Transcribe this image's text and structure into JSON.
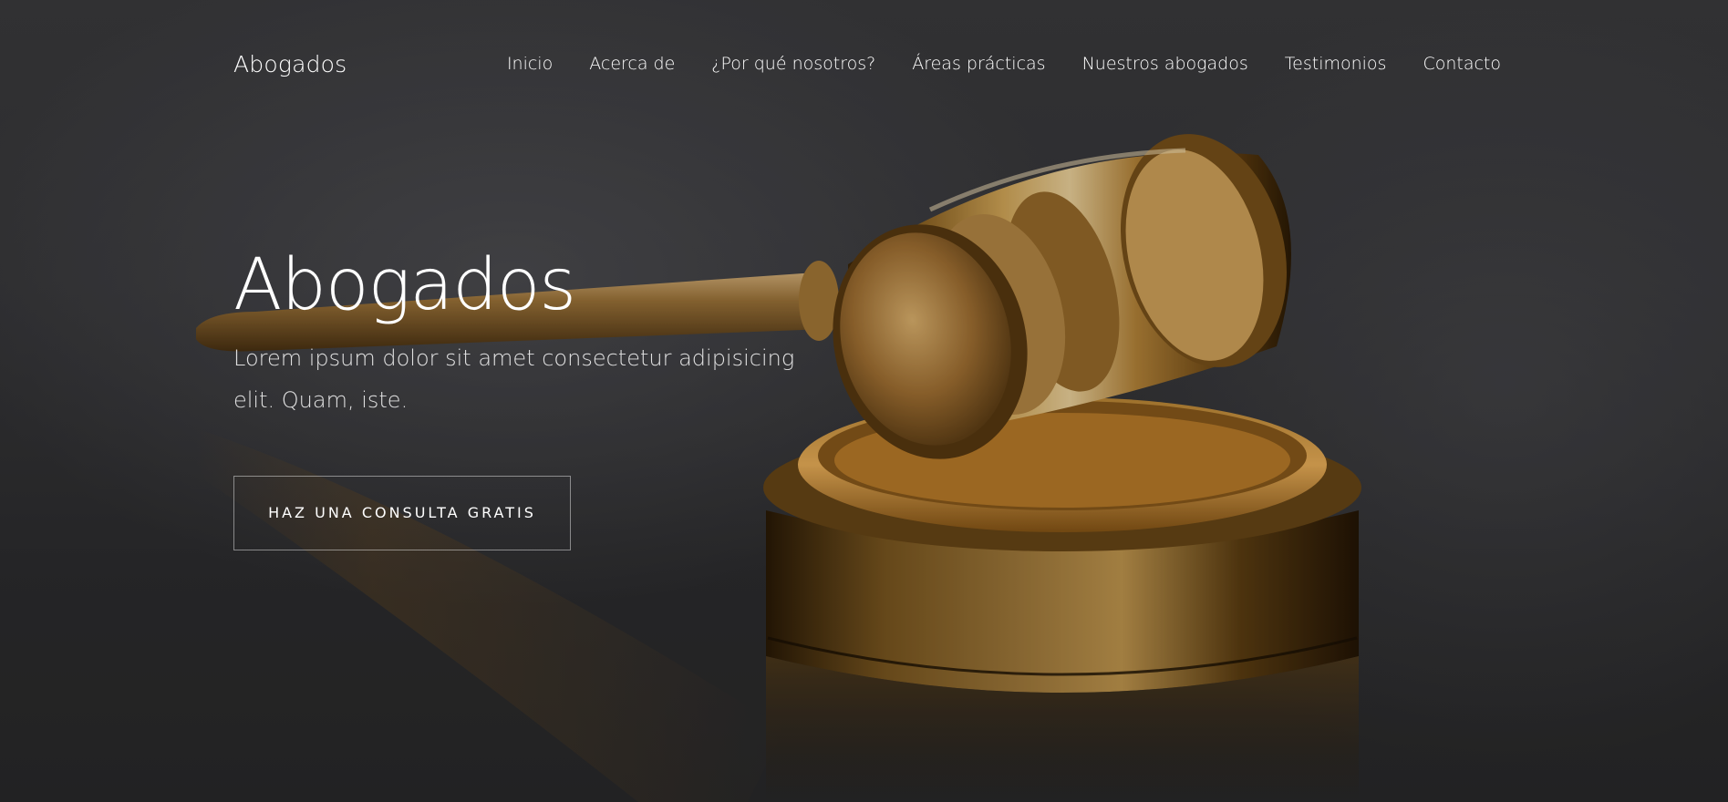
{
  "brand": "Abogados",
  "nav": {
    "items": [
      {
        "label": "Inicio"
      },
      {
        "label": "Acerca de"
      },
      {
        "label": "¿Por qué nosotros?"
      },
      {
        "label": "Áreas prácticas"
      },
      {
        "label": "Nuestros abogados"
      },
      {
        "label": "Testimonios"
      },
      {
        "label": "Contacto"
      }
    ]
  },
  "hero": {
    "title": "Abogados",
    "subtitle": "Lorem ipsum dolor sit amet consectetur adipisicing elit. Quam, iste.",
    "cta_label": "HAZ UNA CONSULTA GRATIS",
    "image": "gold-gavel-image"
  },
  "colors": {
    "text": "#ffffff",
    "background": "#38383b",
    "accent_gold": "#b8862f"
  }
}
